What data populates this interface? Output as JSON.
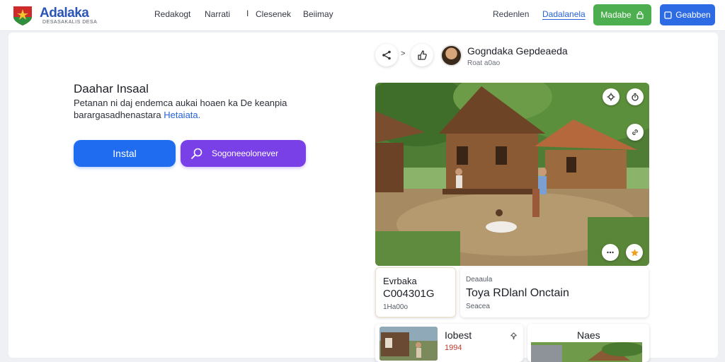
{
  "brand": {
    "name": "Adalaka",
    "tagline": "DESASAKALIS DESA"
  },
  "nav": {
    "items": [
      "Redakogt",
      "Narrati",
      "Clesenek",
      "Beiimay"
    ],
    "separator": "I",
    "right_links": [
      "Redenlen",
      "Dadalanela"
    ],
    "green_button": "Madabe",
    "blue_button": "Geabben"
  },
  "hero": {
    "title": "Daahar Insaal",
    "description": "Petanan ni daj endemca aukai hoaen ka De keanpia barargasadhenastara",
    "description_link": "Hetaiata.",
    "install_button": "Instal",
    "search_button": "Sogoneeolonever"
  },
  "profile": {
    "name": "Gogndaka Gepdeaeda",
    "subtitle": "Roat a0ao",
    "arrow": ">"
  },
  "cards": {
    "card_a": {
      "label": "Evrbaka",
      "value": "C004301G",
      "meta": "1Ha00o"
    },
    "card_b": {
      "label": "Deaaula",
      "value": "Toya RDlanl Onctain",
      "meta": "Seacea"
    },
    "card_c": {
      "title": "Iobest",
      "value": "1994"
    },
    "card_d": {
      "title": "Naes"
    }
  },
  "colors": {
    "primary_blue": "#1f6cf0",
    "purple": "#7a40e8",
    "green": "#4cae4f",
    "link": "#2563d9"
  },
  "icons": [
    "share-icon",
    "like-icon",
    "search-icon",
    "settings-icon",
    "timer-icon",
    "link-icon",
    "more-icon",
    "star-icon",
    "lock-icon",
    "pin-icon"
  ]
}
